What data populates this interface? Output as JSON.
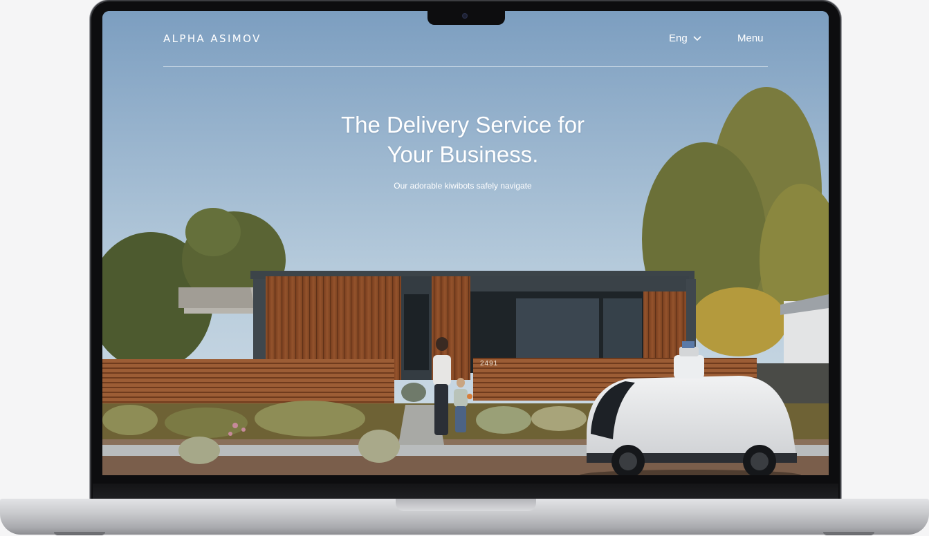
{
  "site": {
    "logo": "ALPHA ASIMOV",
    "nav": {
      "language": "Eng",
      "menu": "Menu"
    }
  },
  "hero": {
    "title_line1": "The Delivery Service for",
    "title_line2": "Your Business.",
    "subtitle": "Our adorable kiwibots safely navigate"
  },
  "scene": {
    "house_number": "2491"
  },
  "icons": {
    "language_dropdown": "chevron-down-icon",
    "camera": "camera-icon"
  },
  "colors": {
    "sky_top": "#7c9ec0",
    "sky_bottom": "#c9dae6",
    "wood": "#8a4a26",
    "robot": "#e8e9eb",
    "text": "#ffffff"
  }
}
